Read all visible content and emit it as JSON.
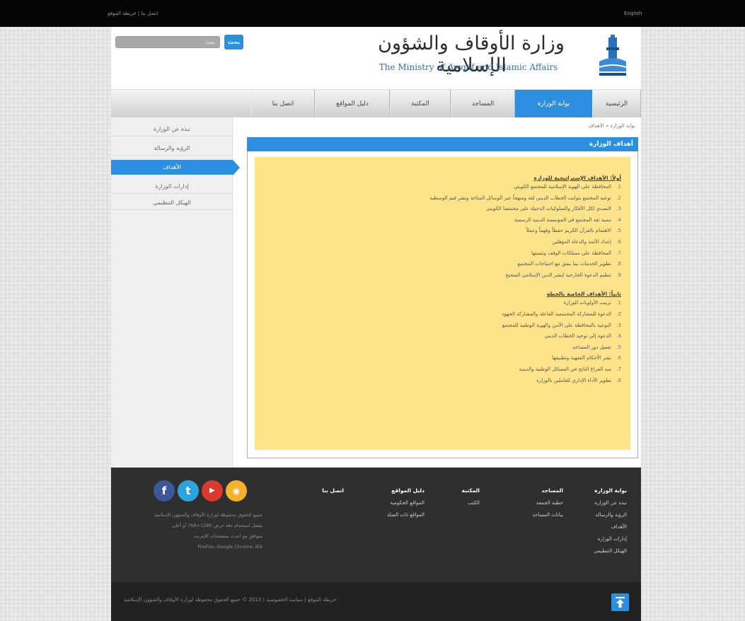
{
  "topbar": {
    "links": "اتصل بنا | خريطة الموقع",
    "lang": "English"
  },
  "header": {
    "search_placeholder": "بحث",
    "search_button": "بحث",
    "logo_arabic": "وزارة الأوقاف والشؤون الإسلامية",
    "logo_english": "The Ministry of Awqaf and Islamic Affairs"
  },
  "nav": {
    "home": "الرئيسية",
    "ministry": "بوابة الوزارة",
    "mosques": "المساجد",
    "library": "المكتبة",
    "directory": "دليل المواقع",
    "contact": "اتصل بنا"
  },
  "sidebar": {
    "items": [
      {
        "label": "نبذة عن الوزارة"
      },
      {
        "label": "الرؤية والرسالة"
      },
      {
        "label": "الأهداف"
      },
      {
        "label": "إدارات الوزارة"
      },
      {
        "label": "الهيكل التنظيمي"
      }
    ]
  },
  "breadcrumb": "بوابة الوزارة « الأهداف",
  "page_title": "أهداف الوزارة",
  "sections": [
    {
      "title": "أولاً: الأهداف الإستراتيجية للوزارة",
      "goals": [
        "المحافظة على الهوية الإسلامية للمجتمع الكويتي",
        "توعية المجتمع بثوابت الخطاب الديني لغة ومنهجاً عبر الوسائل المتاحة ونشر قيم الوسطية",
        "التصدي لكل الأفكار والسلوكيات الدخيلة على مجتمعنا الكويتي",
        "تنمية ثقة المجتمع في المؤسسة الدينية الرسمية",
        "الاهتمام بالقرآن الكريم حفظاً وفهماً وعملاً",
        "إعداد الأئمة والدعاة المؤهلين",
        "المحافظة على ممتلكات الوقف وتنميتها",
        "تطوير الخدمات بما يتفق مع احتياجات المجتمع",
        "تنظيم الدعوة الخارجية لنشر الدين الإسلامي الصحيح"
      ]
    },
    {
      "title": "ثانياً: الأهداف الخاصة بالخطة",
      "goals": [
        "ترتيب الأولويات للوزارة",
        "الدعوة للمشاركة المجتمعية الفاعلة والمشاركة الجهود",
        "التوعية بالمحافظة على الأمن والهوية الوطنية للمجتمع",
        "الدعوة إلى توحيد الخطاب الديني",
        "تفعيل دور المساجد",
        "نشر الأحكام الفقهية وتطبيقها",
        "سد الفراغ الناتج في المسائل الوطنية والدينية",
        "تطوير الأداء الإداري للعاملين بالوزارة"
      ]
    }
  ],
  "footer": {
    "cols": [
      {
        "head": "بوابة الوزارة",
        "items": [
          "نبذة عن الوزارة",
          "الرؤية والرسالة",
          "الأهداف",
          "إدارات الوزارة",
          "الهيكل التنظيمي"
        ]
      },
      {
        "head": "المساجد",
        "items": [
          "خطبة الجمعة",
          "بيانات المساجد"
        ]
      },
      {
        "head": "المكتبة",
        "items": [
          "الكتب"
        ]
      },
      {
        "head": "دليل المواقع",
        "items": [
          "المواقع الحكومية",
          "المواقع ذات الصلة"
        ]
      },
      {
        "head": "اتصل بنا",
        "items": []
      }
    ],
    "note_lines": [
      "جميع الحقوق محفوظة لوزارة الأوقاف والشؤون الإسلامية",
      "يفضل استخدام دقة عرض 1280×768 أو أعلى",
      "متوافق مع أحدث متصفحات الإنترنت",
      "FireFox, Google Chrome, IE9"
    ],
    "bottom_text": "خريطة الموقع  |  سياسة الخصوصية  |  2013 © جميع الحقوق محفوظة لوزارة الأوقاف والشؤون الإسلامية"
  }
}
